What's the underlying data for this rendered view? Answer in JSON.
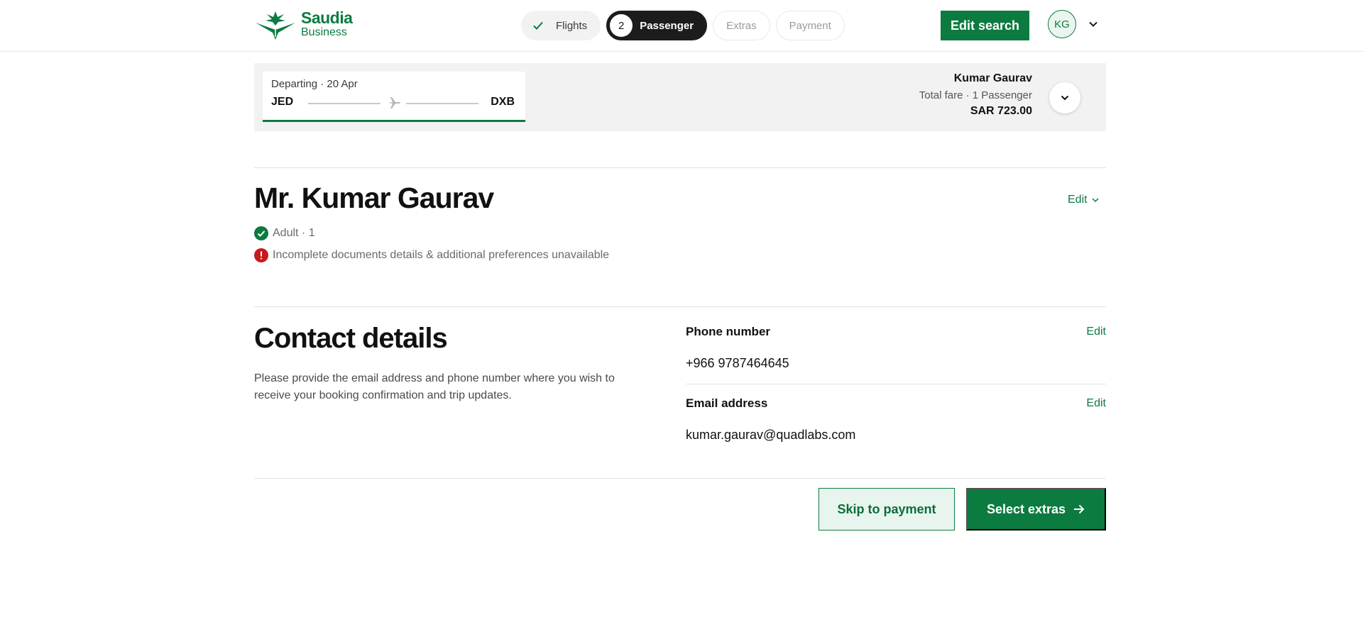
{
  "header": {
    "logo_brand": "Saudia",
    "logo_sub": "Business",
    "steps": [
      {
        "label": "Flights",
        "state": "done"
      },
      {
        "label": "Passenger",
        "number": "2",
        "state": "active"
      },
      {
        "label": "Extras",
        "state": "upcoming"
      },
      {
        "label": "Payment",
        "state": "upcoming"
      }
    ],
    "edit_search_label": "Edit search",
    "avatar_initials": "KG"
  },
  "summary": {
    "departing": "Departing · 20 Apr",
    "from": "JED",
    "to": "DXB",
    "passenger_name": "Kumar Gaurav",
    "fare_label": "Total fare · 1 Passenger",
    "fare_amount": "SAR 723.00"
  },
  "passenger": {
    "name": "Mr. Kumar Gaurav",
    "edit_label": "Edit",
    "type": "Adult · 1",
    "warning": "Incomplete documents details & additional preferences unavailable"
  },
  "contact": {
    "title": "Contact details",
    "description": "Please provide the email address and phone number where you wish to receive your booking confirmation and trip updates.",
    "phone_label": "Phone number",
    "phone_value": "+966 9787464645",
    "email_label": "Email address",
    "email_value": "kumar.gaurav@quadlabs.com",
    "edit_label": "Edit"
  },
  "actions": {
    "skip_label": "Skip to payment",
    "extras_label": "Select extras"
  },
  "colors": {
    "brand_green": "#0c7b40",
    "warning_red": "#c8191c",
    "dark": "#1c1c1c"
  }
}
